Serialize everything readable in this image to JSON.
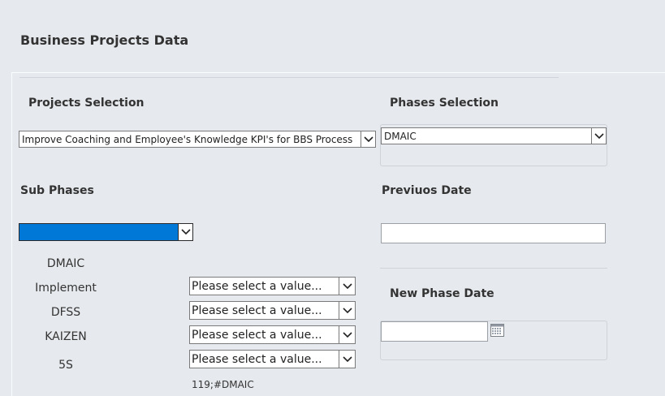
{
  "page": {
    "title": "Business Projects Data"
  },
  "projects_selection": {
    "label": "Projects Selection",
    "selected": "Improve Coaching and Employee's Knowledge KPI's for BBS Process"
  },
  "phases_selection": {
    "label": "Phases Selection",
    "selected": "DMAIC"
  },
  "sub_phases": {
    "label": "Sub Phases",
    "selected": "",
    "rows": [
      {
        "label": "DMAIC"
      },
      {
        "label": "Implement",
        "select_placeholder": "Please select a value..."
      },
      {
        "label": "DFSS",
        "select_placeholder": "Please select a value..."
      },
      {
        "label": "KAIZEN",
        "select_placeholder": "Please select a value..."
      },
      {
        "label": "5S",
        "select_placeholder": "Please select a value..."
      }
    ],
    "footer_value": "119;#DMAIC"
  },
  "previous_date": {
    "label": "Previuos Date",
    "value": ""
  },
  "new_phase_date": {
    "label": "New Phase Date",
    "value": ""
  },
  "icons": {
    "dropdown": "chevron-down-icon",
    "calendar": "calendar-icon"
  },
  "colors": {
    "background": "#e6e9ed",
    "selection_blue": "#0078d7"
  }
}
